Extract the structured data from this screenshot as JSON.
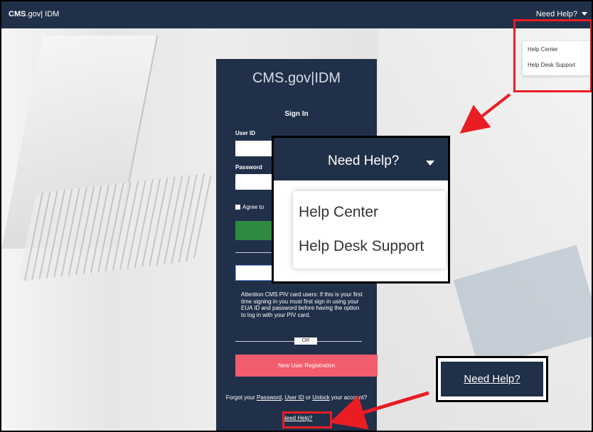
{
  "header": {
    "brand_cms": "CMS",
    "brand_rest": ".gov| IDM",
    "need_help": "Need Help?"
  },
  "top_menu": {
    "items": [
      "Help Center",
      "Help Desk Support"
    ]
  },
  "login": {
    "logo": "CMS.gov|IDM",
    "sign_in": "Sign In",
    "user_id_label": "User ID",
    "password_label": "Password",
    "agree_label": "Agree to",
    "attention": "Attention CMS PIV card users: If this is your first time signing in you must first sign in using your EUA ID and password before having the option to log in with your PIV card.",
    "or": "OR",
    "new_user_registration": "New User Registration",
    "forgot_prefix": "Forgot your",
    "password_link": "Password",
    "user_id_link": "User ID",
    "or_word": "or",
    "unlock_link": "Unlock",
    "forgot_suffix": "your account?",
    "need_help": "Need Help?"
  },
  "zoom_callout": {
    "need_help": "Need Help?",
    "items": [
      "Help Center",
      "Help Desk Support"
    ]
  },
  "bottom_callout": {
    "need_help": "Need Help?"
  },
  "colors": {
    "nav": "#213049",
    "sign_in_button": "#2e8941",
    "registration_button": "#f25d6d",
    "highlight": "#ea1d25"
  }
}
